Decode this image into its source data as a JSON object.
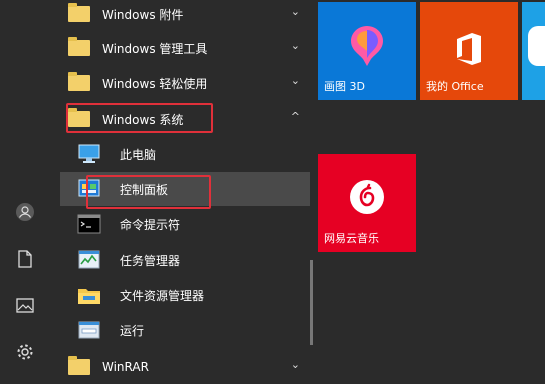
{
  "menu": {
    "items": [
      {
        "label": "Windows 附件",
        "chevron": "⌄"
      },
      {
        "label": "Windows 管理工具",
        "chevron": "⌄"
      },
      {
        "label": "Windows 轻松使用",
        "chevron": "⌄"
      },
      {
        "label": "Windows 系统",
        "chevron": "^"
      }
    ],
    "sub_items": [
      {
        "label": "此电脑"
      },
      {
        "label": "控制面板"
      },
      {
        "label": "命令提示符"
      },
      {
        "label": "任务管理器"
      },
      {
        "label": "文件资源管理器"
      },
      {
        "label": "运行"
      }
    ],
    "bottom_item": {
      "label": "WinRAR",
      "chevron": "⌄"
    }
  },
  "tiles": {
    "paint3d": {
      "label": "画图 3D"
    },
    "office": {
      "label": "我的 Office"
    },
    "netease": {
      "label": "网易云音乐"
    }
  },
  "colors": {
    "background": "#2b2b2b",
    "tile_blue": "#0a78d7",
    "tile_office": "#e5480b",
    "tile_netease": "#e60023",
    "highlight_box": "#e0303a"
  }
}
